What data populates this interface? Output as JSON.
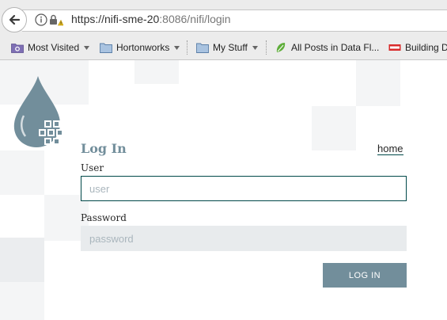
{
  "browser": {
    "url_host": "https://nifi-sme-20",
    "url_rest": ":8086/nifi/login",
    "bookmarks": [
      {
        "label": "Most Visited",
        "icon": "gear-folder-icon"
      },
      {
        "label": "Hortonworks",
        "icon": "folder-icon"
      },
      {
        "label": "My Stuff",
        "icon": "folder-icon"
      },
      {
        "label": "All Posts in Data Fl...",
        "icon": "leaf-icon"
      },
      {
        "label": "Building D",
        "icon": "site-badge-icon"
      }
    ]
  },
  "login": {
    "title": "Log In",
    "home_link": "home",
    "user_label": "User",
    "user_placeholder": "user",
    "password_label": "Password",
    "password_placeholder": "password",
    "login_button": "LOG IN"
  },
  "colors": {
    "accent": "#728e9b",
    "focus_border": "#004849",
    "text": "#262626"
  }
}
